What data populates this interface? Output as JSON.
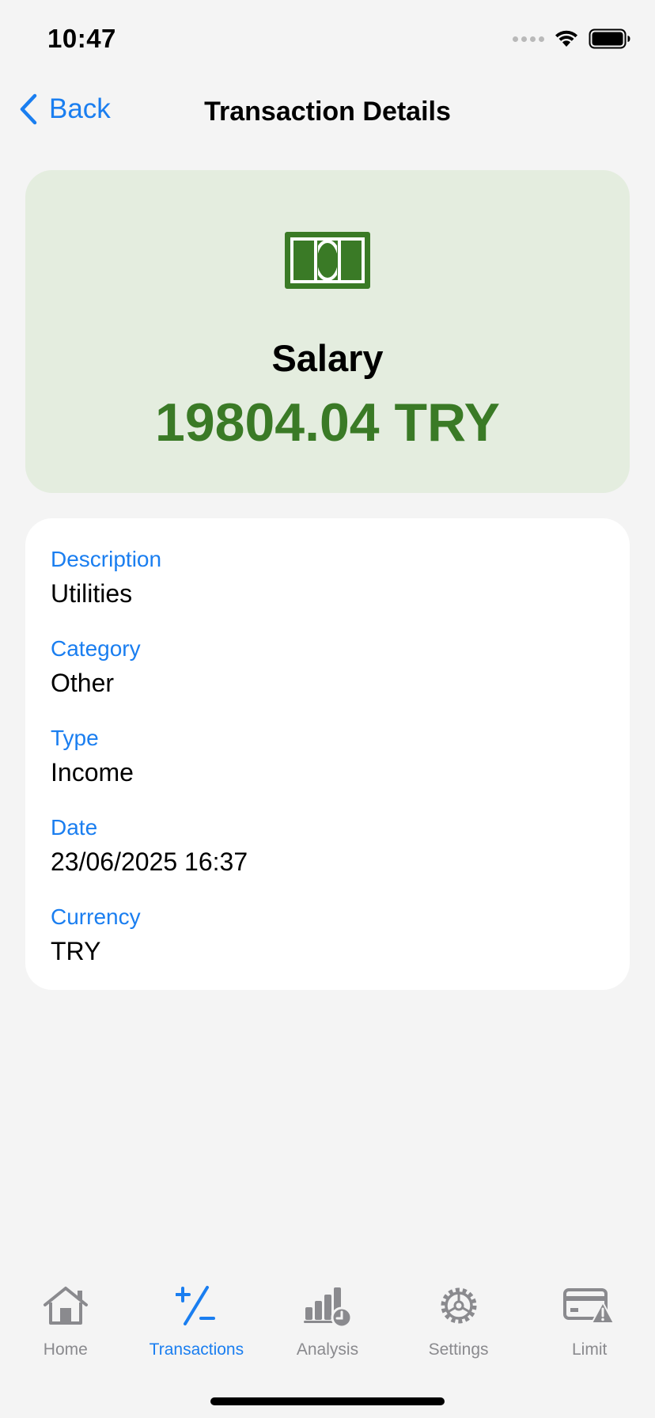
{
  "status_bar": {
    "time": "10:47"
  },
  "nav": {
    "back_label": "Back",
    "title": "Transaction Details"
  },
  "summary": {
    "icon": "banknote-icon",
    "category": "Salary",
    "amount": "19804.04 TRY",
    "colors": {
      "background": "#e4eddf",
      "accent": "#3a7a26"
    }
  },
  "details": [
    {
      "label": "Description",
      "value": "Utilities"
    },
    {
      "label": "Category",
      "value": "Other"
    },
    {
      "label": "Type",
      "value": "Income"
    },
    {
      "label": "Date",
      "value": "23/06/2025 16:37"
    },
    {
      "label": "Currency",
      "value": "TRY"
    }
  ],
  "tabs": [
    {
      "label": "Home",
      "icon": "house-icon",
      "active": false
    },
    {
      "label": "Transactions",
      "icon": "plus-minus-icon",
      "active": true
    },
    {
      "label": "Analysis",
      "icon": "chart-clock-icon",
      "active": false
    },
    {
      "label": "Settings",
      "icon": "gear-icon",
      "active": false
    },
    {
      "label": "Limit",
      "icon": "card-warning-icon",
      "active": false
    }
  ],
  "colors": {
    "accent": "#1a7ef0",
    "tab_inactive": "#8a8a8e"
  }
}
